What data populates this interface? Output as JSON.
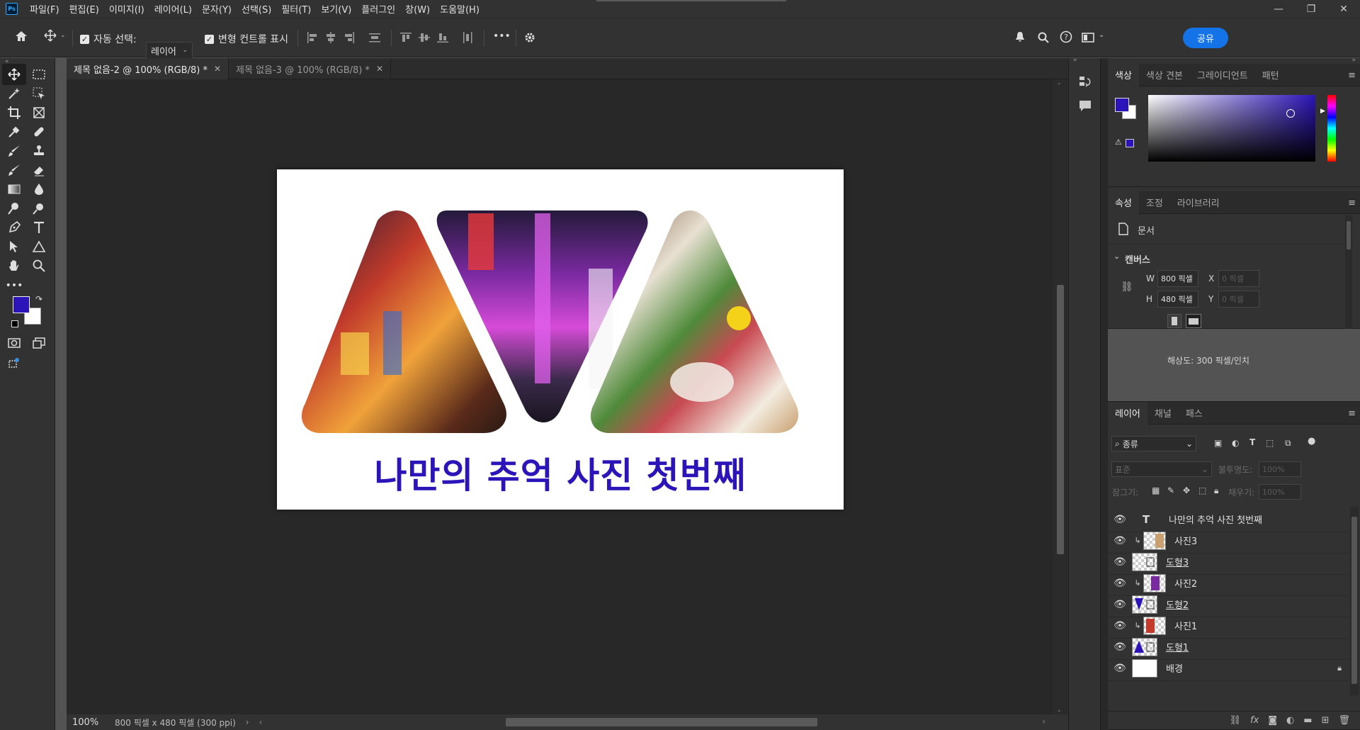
{
  "app": {
    "name": "Photoshop",
    "logo_text": "Ps"
  },
  "menu": [
    "파일(F)",
    "편집(E)",
    "이미지(I)",
    "레이어(L)",
    "문자(Y)",
    "선택(S)",
    "필터(T)",
    "보기(V)",
    "플러그인",
    "창(W)",
    "도움말(H)"
  ],
  "window_controls": {
    "minimize": "—",
    "restore": "❐",
    "close": "✕"
  },
  "options": {
    "auto_select_label": "자동 선택:",
    "auto_select_checked": true,
    "auto_select_target": "레이어",
    "transform_controls_label": "변형 컨트롤 표시",
    "transform_controls_checked": true,
    "more": "•••",
    "share": "공유"
  },
  "doc_tabs": [
    {
      "title": "제목 없음-2 @ 100% (RGB/8) *",
      "active": true
    },
    {
      "title": "제목 없음-3 @ 100% (RGB/8) *",
      "active": false
    }
  ],
  "canvas": {
    "title_text": "나만의 추억 사진 첫번째"
  },
  "status": {
    "zoom": "100%",
    "doc_info": "800 픽셀 x 480 픽셀 (300 ppi)"
  },
  "colors": {
    "foreground": "#2b14b8",
    "background": "#ffffff",
    "accent": "#1473e6"
  },
  "color_panel": {
    "tabs": [
      "색상",
      "색상 견본",
      "그레이디언트",
      "패턴"
    ]
  },
  "props_panel": {
    "tabs": [
      "속성",
      "조정",
      "라이브러리"
    ],
    "doc_label": "문서",
    "canvas_section": "캔버스",
    "w_label": "W",
    "w_value": "800 픽셀",
    "h_label": "H",
    "h_value": "480 픽셀",
    "x_label": "X",
    "x_value": "0 픽셀",
    "y_label": "Y",
    "y_value": "0 픽셀",
    "resolution": "해상도: 300 픽셀/인치"
  },
  "layers_panel": {
    "tabs": [
      "레이어",
      "채널",
      "패스"
    ],
    "filter_kind": "종류",
    "blend_mode": "표준",
    "opacity_label": "불투명도:",
    "opacity_value": "100%",
    "lock_label": "잠그기:",
    "fill_label": "채우기:",
    "fill_value": "100%",
    "layers": [
      {
        "name": "나만의 추억 사진 첫번째",
        "kind": "text"
      },
      {
        "name": "사진3",
        "kind": "clip"
      },
      {
        "name": "도형3",
        "kind": "shape"
      },
      {
        "name": "사진2",
        "kind": "clip"
      },
      {
        "name": "도형2",
        "kind": "shape"
      },
      {
        "name": "사진1",
        "kind": "clip"
      },
      {
        "name": "도형1",
        "kind": "shape"
      },
      {
        "name": "배경",
        "kind": "background"
      }
    ]
  }
}
